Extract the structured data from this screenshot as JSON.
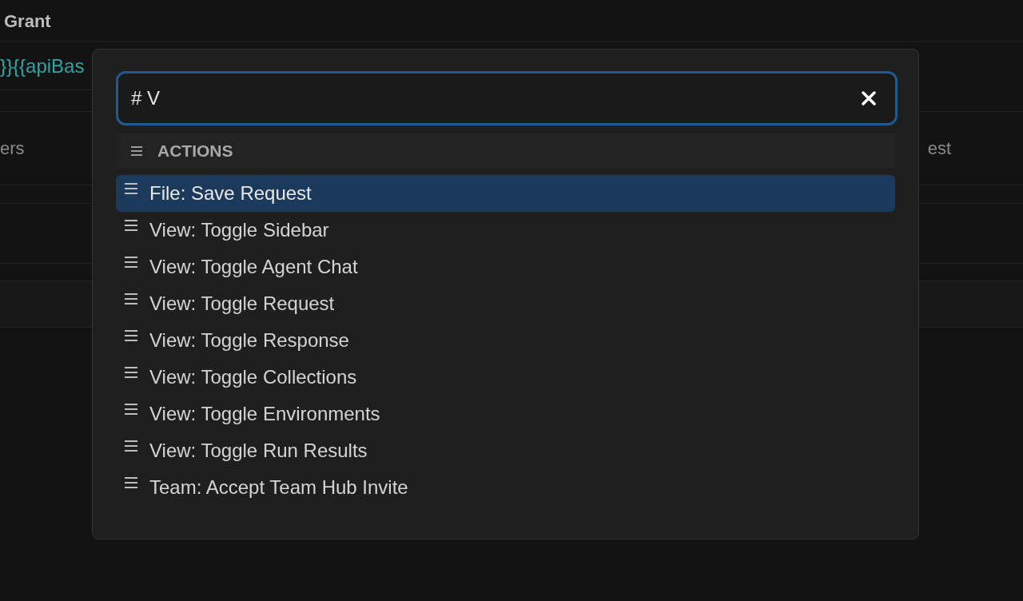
{
  "background": {
    "tab_label": "Grant",
    "url_fragment": "}}{{apiBas",
    "left_label": "ers",
    "right_label": "est"
  },
  "command_palette": {
    "query": "# V",
    "section": {
      "title": "ACTIONS"
    },
    "items": [
      {
        "label": "File: Save Request",
        "selected": true
      },
      {
        "label": "View: Toggle Sidebar",
        "selected": false
      },
      {
        "label": "View: Toggle Agent Chat",
        "selected": false
      },
      {
        "label": "View: Toggle Request",
        "selected": false
      },
      {
        "label": "View: Toggle Response",
        "selected": false
      },
      {
        "label": "View: Toggle Collections",
        "selected": false
      },
      {
        "label": "View: Toggle Environments",
        "selected": false
      },
      {
        "label": "View: Toggle Run Results",
        "selected": false
      },
      {
        "label": "Team: Accept Team Hub Invite",
        "selected": false
      }
    ]
  }
}
